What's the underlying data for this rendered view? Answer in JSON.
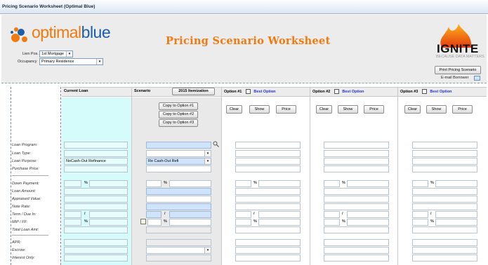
{
  "window": {
    "title": "Pricing Scenario Worksheet (Optimal Blue)"
  },
  "brand": {
    "opt": "optimal",
    "blue": "blue",
    "ignite": "IGNITE",
    "tagline": "BECAUSE DATA MATTERS"
  },
  "page_title": "Pricing Scenario Worksheet",
  "header": {
    "lien_label": "Lien Pos.",
    "lien_value": "1st Mortgage",
    "occupancy_label": "Occupancy",
    "occupancy_value": "Primary Residence",
    "print_button": "Print Pricing Scenario",
    "email_label": "E-mail Borrower"
  },
  "columns": {
    "current": "Current Loan",
    "scenario": "Scenario",
    "itemization_button": "2015 Itemization",
    "option1": "Option #1",
    "option2": "Option #2",
    "option3": "Option #3",
    "best": "Best Option"
  },
  "copy_buttons": [
    "Copy to Option #1",
    "Copy to Option #2",
    "Copy to Option #3"
  ],
  "option_buttons": {
    "clear": "Clear",
    "show": "Show",
    "price": "Price"
  },
  "row_labels": [
    "Loan Program:",
    "Loan Type:",
    "Loan Purpose:",
    "Purchase Price:",
    "Down Payment:",
    "Loan Amount:",
    "Appraised Value:",
    "Note Rate:",
    "Term / Due In:",
    "MIP / FF:",
    "Total Loan Amt:",
    "APR:",
    "Escrow:",
    "Interest Only:"
  ],
  "values": {
    "current_purpose": "NoCash-Out Refinance",
    "scenario_purpose": "Re Cash-Out Refi"
  },
  "symbols": {
    "pct": "%",
    "slash": "/",
    "dropdown": "▾"
  }
}
